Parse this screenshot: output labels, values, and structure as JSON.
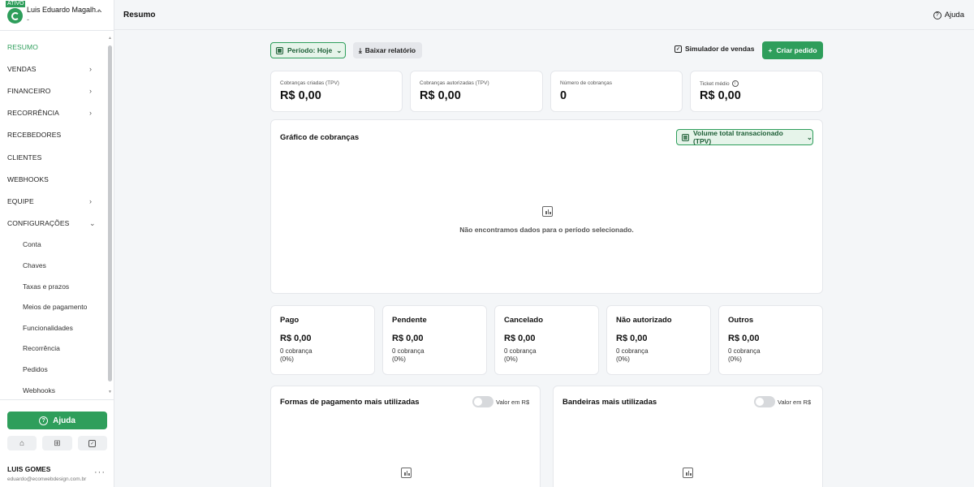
{
  "account": {
    "badge": "ATIVO",
    "name": "Luis Eduardo Magalh...",
    "subtitle": "-"
  },
  "nav": {
    "items": [
      {
        "label": "RESUMO",
        "active": true,
        "chevron": ""
      },
      {
        "label": "VENDAS",
        "chevron": "›"
      },
      {
        "label": "FINANCEIRO",
        "chevron": "›"
      },
      {
        "label": "RECORRÊNCIA",
        "chevron": "›"
      },
      {
        "label": "RECEBEDORES",
        "chevron": ""
      },
      {
        "label": "CLIENTES",
        "chevron": ""
      },
      {
        "label": "WEBHOOKS",
        "chevron": ""
      },
      {
        "label": "EQUIPE",
        "chevron": "›"
      },
      {
        "label": "CONFIGURAÇÕES",
        "chevron": "⌄"
      }
    ],
    "subitems": [
      "Conta",
      "Chaves",
      "Taxas e prazos",
      "Meios de pagamento",
      "Funcionalidades",
      "Recorrência",
      "Pedidos",
      "Webhooks"
    ]
  },
  "sidebar_footer": {
    "help_label": "Ajuda",
    "user_name": "LUIS GOMES",
    "user_email": "eduardo@econwebdesign.com.br"
  },
  "header": {
    "title": "Resumo",
    "help_label": "Ajuda"
  },
  "toolbar": {
    "period_label": "Período: Hoje",
    "report_label": "Baixar relatório",
    "simulator_label": "Simulador de vendas",
    "create_label": "Criar pedido"
  },
  "kpis": [
    {
      "label": "Cobranças criadas (TPV)",
      "value": "R$ 0,00"
    },
    {
      "label": "Cobranças autorizadas (TPV)",
      "value": "R$ 0,00"
    },
    {
      "label": "Número de cobranças",
      "value": "0"
    },
    {
      "label": "Ticket médio",
      "value": "R$ 0,00"
    }
  ],
  "chart": {
    "title": "Gráfico de cobranças",
    "metric_select": "Volume total transacionado (TPV)",
    "empty_message": "Não encontramos dados para o período selecionado."
  },
  "statuses": [
    {
      "title": "Pago",
      "value": "R$ 0,00",
      "count": "0 cobrança",
      "pct": "(0%)"
    },
    {
      "title": "Pendente",
      "value": "R$ 0,00",
      "count": "0 cobrança",
      "pct": "(0%)"
    },
    {
      "title": "Cancelado",
      "value": "R$ 0,00",
      "count": "0 cobrança",
      "pct": "(0%)"
    },
    {
      "title": "Não autorizado",
      "value": "R$ 0,00",
      "count": "0 cobrança",
      "pct": "(0%)"
    },
    {
      "title": "Outros",
      "value": "R$ 0,00",
      "count": "0 cobrança",
      "pct": "(0%)"
    }
  ],
  "payment_methods": {
    "title": "Formas de pagamento mais utilizadas",
    "toggle_label": "Valor em R$",
    "toggle_on": false
  },
  "card_brands": {
    "title": "Bandeiras mais utilizadas",
    "toggle_label": "Valor em R$",
    "toggle_on": false
  },
  "colors": {
    "accent": "#2e9e5b",
    "accent_light": "#e6f4ea",
    "background": "#f4f6f8"
  }
}
